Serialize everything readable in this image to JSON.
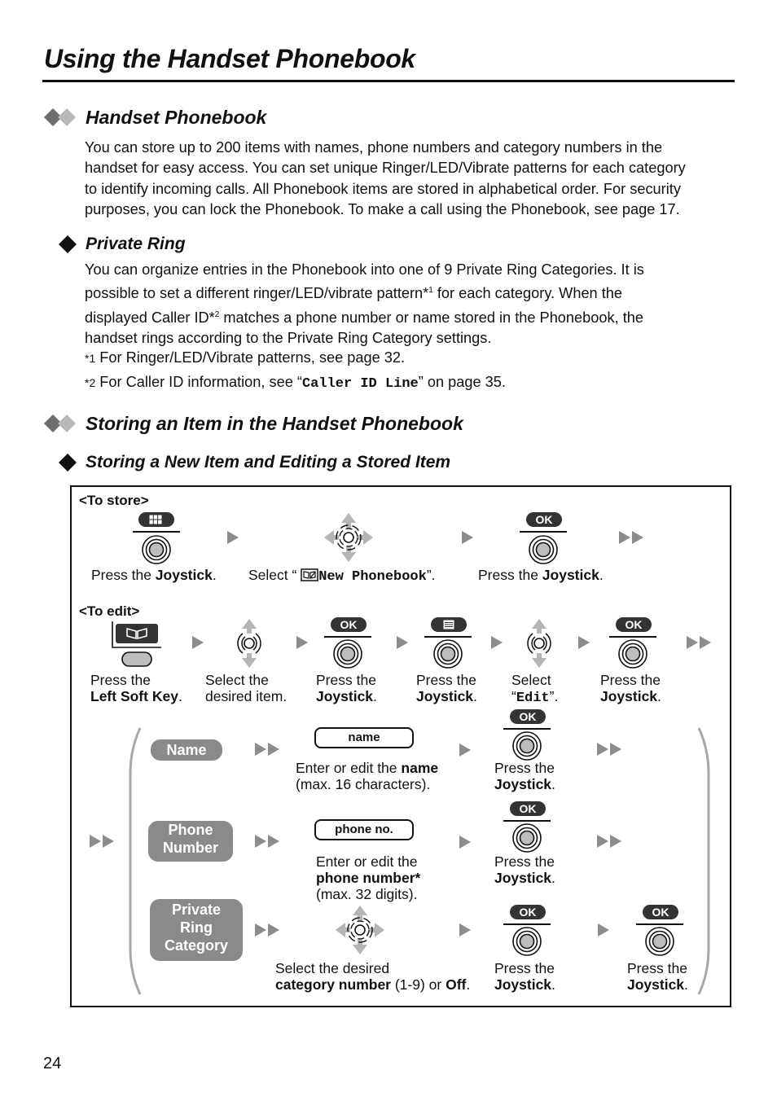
{
  "page": {
    "title": "Using the Handset Phonebook",
    "page_number": "24"
  },
  "section_handset_phonebook": {
    "heading": "Handset Phonebook",
    "lines": [
      "You can store up to 200 items with names, phone numbers and category numbers in the",
      "handset for easy access. You can set unique Ringer/LED/Vibrate patterns for each category",
      "to identify incoming calls. All Phonebook items are stored in alphabetical order. For security",
      "purposes, you can lock the Phonebook. To make a call using the Phonebook, see page 17."
    ]
  },
  "section_private_ring": {
    "heading": "Private Ring",
    "line1": "You can organize entries in the Phonebook into one of 9 Private Ring Categories. It is",
    "line2_a": "possible to set a different ringer/LED/vibrate pattern*",
    "line2_sup": "1",
    "line2_b": " for each category. When the",
    "line3_a": "displayed Caller ID*",
    "line3_sup": "2",
    "line3_b": " matches a phone number or name stored in the Phonebook, the",
    "line4": "handset rings according to the Private Ring Category settings.",
    "footnote1_mark": "*1",
    "footnote1_text": " For Ringer/LED/Vibrate patterns, see page 32.",
    "footnote2_mark": "*2",
    "footnote2_a": " For Caller ID information, see “",
    "footnote2_code": "Caller ID Line",
    "footnote2_b": "” on page 35."
  },
  "section_storing": {
    "heading": "Storing an Item in the Handset Phonebook",
    "subheading": "Storing a New Item and Editing a Stored Item"
  },
  "diagram": {
    "to_store": {
      "label": "<To store>",
      "step1": {
        "a": "Press the ",
        "b": "Joystick",
        "c": "."
      },
      "step2": {
        "a": "Select “",
        "code": "New Phonebook",
        "c": "”."
      },
      "step3": {
        "a": "Press the ",
        "b": "Joystick",
        "c": "."
      }
    },
    "to_edit": {
      "label": "<To edit>",
      "step1": {
        "a": "Press the",
        "b": "Left Soft Key",
        "c": "."
      },
      "step2": {
        "a": "Select the",
        "b": "desired item."
      },
      "step3": {
        "a": "Press the",
        "b": "Joystick",
        "c": "."
      },
      "step4": {
        "a": "Press the",
        "b": "Joystick",
        "c": "."
      },
      "step5": {
        "a": "Select",
        "q1": "“",
        "code": "Edit",
        "q2": "”."
      },
      "step6": {
        "a": "Press the",
        "b": "Joystick",
        "c": "."
      }
    },
    "ok_label": "OK",
    "press_the": "Press the",
    "joystick": "Joystick",
    "period": ".",
    "fields": {
      "name": {
        "pill": "Name",
        "field_value": "name",
        "desc_a": "Enter or edit the ",
        "desc_b": "name",
        "desc_c": "(max. 16 characters)."
      },
      "phone": {
        "pill_1": "Phone",
        "pill_2": "Number",
        "field_value": "phone no.",
        "desc_a": "Enter or edit the",
        "desc_b": "phone number*",
        "desc_c": "(max. 32 digits)."
      },
      "category": {
        "pill_1": "Private",
        "pill_2": "Ring",
        "pill_3": "Category",
        "desc_a": "Select the desired",
        "desc_b": "category number",
        "desc_c": " (1-9) or ",
        "desc_d": "Off",
        "desc_e": "."
      }
    },
    "colors": {
      "arrow_gray": "#8c8c8c",
      "pill_gray": "#8a8a8a",
      "key_dark": "#333333",
      "joystick_light": "#bdbdbd"
    }
  }
}
